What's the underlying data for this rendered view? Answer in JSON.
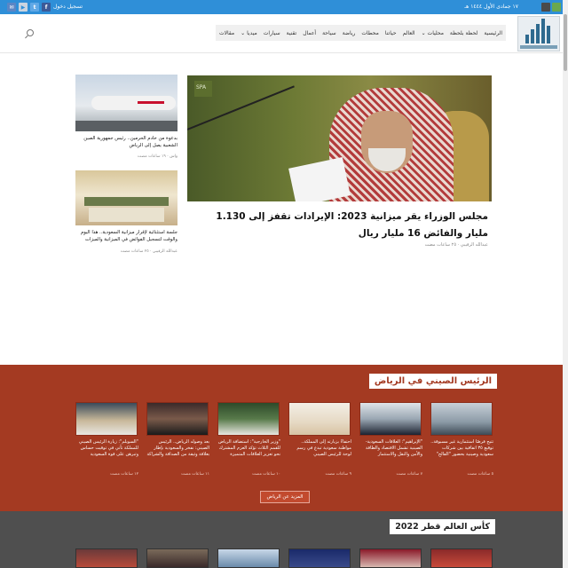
{
  "topbar": {
    "date": "١٧ جمادى الأول ١٤٤٤ هـ",
    "login": "تسجيل دخول",
    "social_icons": [
      "facebook-icon",
      "twitter-icon",
      "instagram-icon",
      "youtube-icon",
      "mail-icon"
    ],
    "app_icons": [
      "apple-icon",
      "android-icon"
    ],
    "colors": {
      "bar": "#2f8fd8"
    }
  },
  "header": {
    "logo_icon": "site-logo",
    "nav": [
      "الرئيسية",
      "لحظة بلحظة",
      "محليات ⌄",
      "العالم",
      "حياتنا",
      "محطات",
      "رياضة",
      "سياحة",
      "أعمال",
      "تقنية",
      "سيارات",
      "ميديا ⌄",
      "مقالات"
    ]
  },
  "hero": {
    "title": "مجلس الوزراء يقر ميزانية 2023: الإيرادات تقفز إلى 1.130 مليار والفائض 16 مليار ريال",
    "author": "عبدالله الرقيبي",
    "time": "٢٥ ساعات مضت"
  },
  "side_news": [
    {
      "title": "بدعوة من خادم الحرمين.. رئيس جمهورية الصين الشعبية يصل إلى الرياض",
      "meta": "واس · ١٩ ساعات مضت"
    },
    {
      "title": "جلسة استثنائية لإقرار ميزانية السعودية.. هذا اليوم والوقت لتسجيل الفوائض في الميزانية والميزات",
      "meta": "عبدالله الرقيبي · ٢٥ ساعات مضت"
    }
  ],
  "red_section": {
    "title": "الرئيس الصيني في الرياض",
    "more": "المزيد عن الرياض",
    "cards": [
      {
        "title": "تتيح فرصًا استثمارية غير مسبوقة.. توقيع ٣٥ اتفاقية بين شركات سعودية وصينية بحضور \"الفالح\"",
        "meta": "٥ ساعات مضت"
      },
      {
        "title": "\"الإبراهيم\": العلاقات السعودية-الصينية تشمل الاقتصاد والطاقة والأمن والنقل والاستثمار",
        "meta": "٧ ساعات مضت"
      },
      {
        "title": "احتفاءً بزيارته إلى المملكة.. مواطنة سعودية تبدع في رسم لوحة للرئيس الصيني",
        "meta": "٩ ساعات مضت"
      },
      {
        "title": "\"وزير الخارجية\": استضافة الرياض للقمم الثلاث تؤكد العزم المشترك نحو تعزيز العلاقات المتميزة",
        "meta": "١٠ ساعات مضت"
      },
      {
        "title": "بعد وصوله الرياض.. الرئيس الصيني: نفخر والسعودية بإطار بعلاقة وثيقة من الصداقة والشراكة",
        "meta": "١١ ساعات مضت"
      },
      {
        "title": "\"السويلم\": زيارة الرئيس الصيني للمملكة تأتي في توقيت حساس وتبرهن على قوة السعودية",
        "meta": "١٢ ساعات مضت"
      }
    ],
    "colors": {
      "bg": "#a43a22"
    }
  },
  "wc_section": {
    "title": "كأس العالم قطر 2022",
    "colors": {
      "bg": "#4f4f4f"
    }
  }
}
